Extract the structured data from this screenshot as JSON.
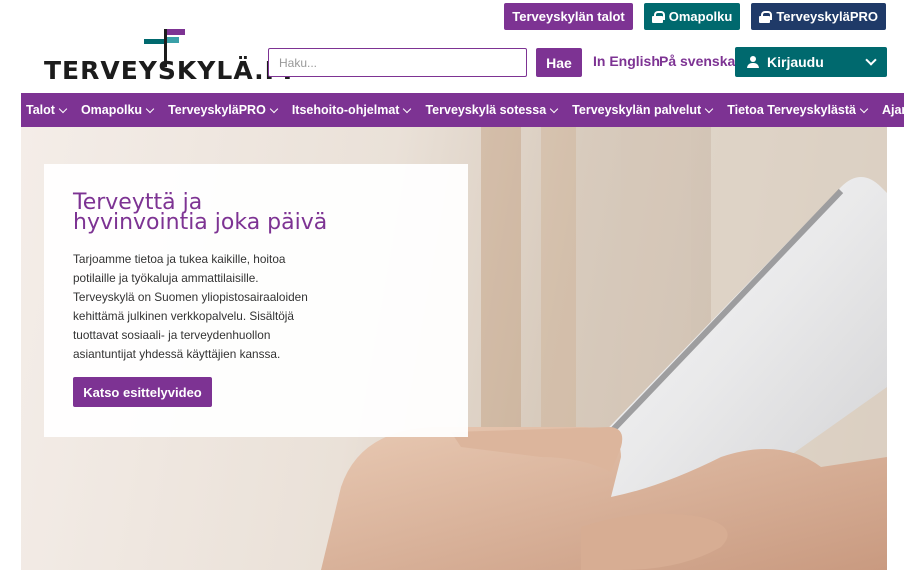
{
  "header": {
    "top_links": {
      "talot": "Terveyskylän talot",
      "omapolku": "Omapolku",
      "pro": "TerveyskyläPRO"
    },
    "logo_text": "TERVEYSKYLÄ.FI",
    "search": {
      "placeholder": "Haku...",
      "button_label": "Hae"
    },
    "languages": {
      "english": "In English",
      "swedish": "På svenska"
    },
    "login_label": "Kirjaudu"
  },
  "nav": {
    "items": [
      {
        "label": "Talot"
      },
      {
        "label": "Omapolku"
      },
      {
        "label": "TerveyskyläPRO"
      },
      {
        "label": "Itsehoito-ohjelmat"
      },
      {
        "label": "Terveyskylä sotessa"
      },
      {
        "label": "Terveyskylän palvelut"
      },
      {
        "label": "Tietoa Terveyskylästä"
      },
      {
        "label": "Ajankohtaista"
      }
    ]
  },
  "hero": {
    "title": "Terveyttä ja hyvinvointia joka päivä",
    "text": "Tarjoamme tietoa ja tukea kaikille, hoitoa potilaille ja työkaluja ammattilaisille. Terveyskylä on Suomen yliopistosairaaloiden kehittämä julkinen verkkopalvelu. Sisältöjä tuottavat sosiaali- ja terveydenhuollon asiantuntijat yhdessä käyttäjien kanssa.",
    "button_label": "Katso esittelyvideo"
  },
  "colors": {
    "primary_purple": "#7d3393",
    "green": "#00696e",
    "navy": "#1f3a68"
  },
  "icons": [
    "lock-icon",
    "user-icon",
    "chevron-down-icon",
    "signpost-logo-icon"
  ]
}
